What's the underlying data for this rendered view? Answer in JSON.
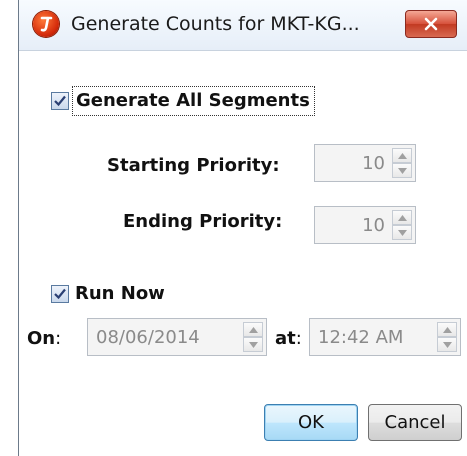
{
  "window": {
    "title": "Generate Counts for MKT-KG...",
    "close_icon": "close-x-icon",
    "app_icon": "app-logo-icon"
  },
  "generate_all": {
    "label": "Generate All Segments",
    "checked": true
  },
  "starting_priority": {
    "label": "Starting Priority:",
    "value": "10"
  },
  "ending_priority": {
    "label": "Ending Priority:",
    "value": "10"
  },
  "run_now": {
    "label": "Run Now",
    "checked": true
  },
  "schedule": {
    "on_label": "On",
    "on_colon": ":",
    "date_value": "08/06/2014",
    "at_label": "at",
    "at_colon": ":",
    "time_value": "12:42 AM"
  },
  "buttons": {
    "ok_label": "OK",
    "cancel_label": "Cancel"
  }
}
